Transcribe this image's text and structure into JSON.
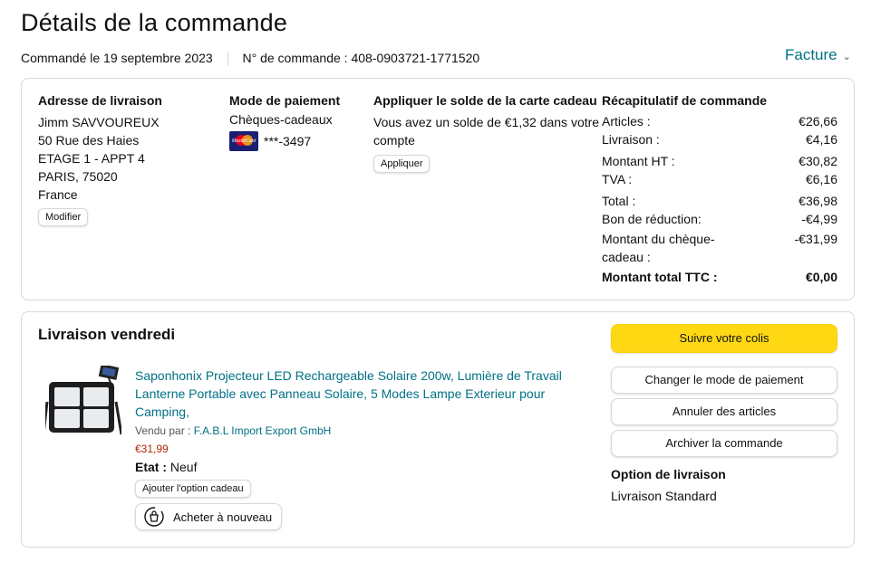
{
  "page": {
    "title": "Détails de la commande",
    "ordered_date": "Commandé le 19 septembre 2023",
    "order_number": "N° de commande : 408-0903721-1771520",
    "invoice_label": "Facture"
  },
  "shipping": {
    "heading": "Adresse de livraison",
    "lines": [
      "Jimm SAVVOUREUX",
      "50 Rue des Haies",
      "ETAGE 1 - APPT 4",
      "PARIS, 75020",
      "France"
    ],
    "edit_label": "Modifier"
  },
  "payment": {
    "heading": "Mode de paiement",
    "method": "Chèques-cadeaux",
    "card_mask": "***-3497",
    "card_brand_text": "MasterCard"
  },
  "gift_card": {
    "heading": "Appliquer le solde de la carte cadeau",
    "text": "Vous avez un solde de €1,32 dans votre compte",
    "apply_label": "Appliquer"
  },
  "summary": {
    "heading": "Récapitulatif de commande",
    "rows": [
      {
        "label": "Articles :",
        "value": "€26,66"
      },
      {
        "label": "Livraison :",
        "value": "€4,16"
      },
      {
        "label": "Montant HT :",
        "value": "€30,82"
      },
      {
        "label": "TVA :",
        "value": "€6,16"
      },
      {
        "label": "Total :",
        "value": "€36,98"
      },
      {
        "label": "Bon de réduction:",
        "value": "-€4,99"
      },
      {
        "label": "Montant du chèque-cadeau :",
        "value": "-€31,99"
      }
    ],
    "grand_total_label": "Montant total TTC :",
    "grand_total_value": "€0,00"
  },
  "delivery": {
    "heading": "Livraison vendredi",
    "product_title": "Saponhonix Projecteur LED Rechargeable Solaire 200w, Lumière de Travail Lanterne Portable avec Panneau Solaire, 5 Modes Lampe Exterieur pour Camping,",
    "sold_by_label": "Vendu par :",
    "seller": "F.A.B.L Import Export GmbH",
    "price": "€31,99",
    "condition_label": "Etat :",
    "condition_value": "Neuf",
    "gift_option_label": "Ajouter l'option cadeau",
    "buy_again_label": "Acheter à nouveau",
    "actions": {
      "track": "Suivre votre colis",
      "change_payment": "Changer le mode de paiement",
      "cancel": "Annuler des articles",
      "archive": "Archiver la commande"
    },
    "option_heading": "Option de livraison",
    "option_value": "Livraison Standard"
  },
  "colors": {
    "link": "#007185",
    "price": "#b12704",
    "accent_button": "#ffd814"
  }
}
